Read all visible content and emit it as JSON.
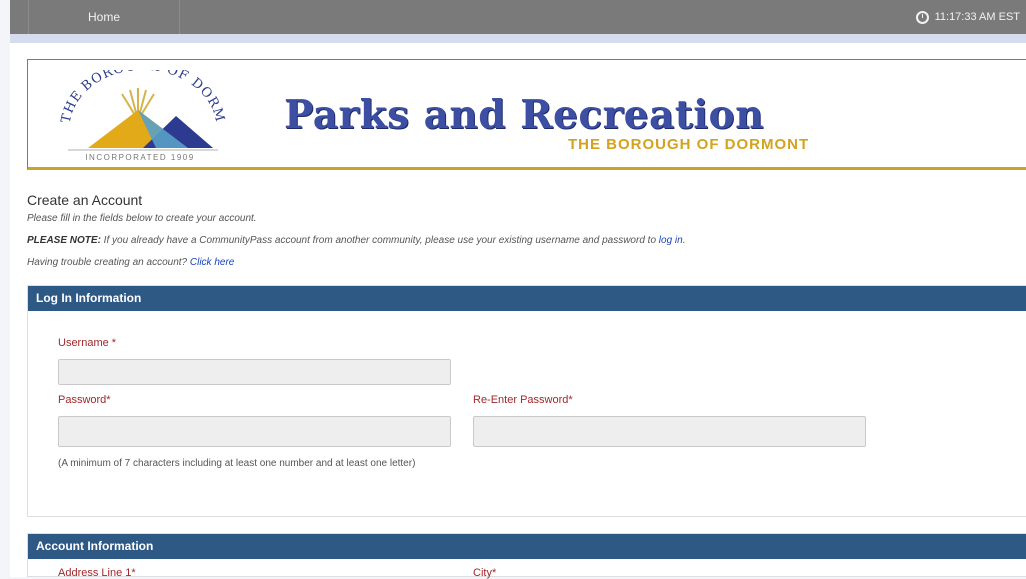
{
  "topbar": {
    "home_label": "Home",
    "time": "11:17:33 AM EST"
  },
  "banner": {
    "logo": {
      "arc_top": "BOROUGH OF DORMONT",
      "arc_left": "THE",
      "incorporated": "INCORPORATED 1909"
    },
    "title": "Parks and Recreation",
    "subtitle": "THE BOROUGH OF DORMONT"
  },
  "intro": {
    "heading": "Create an Account",
    "instructions": "Please fill in the fields below to create your account.",
    "note_label": "PLEASE NOTE:",
    "note_text": " If you already have a CommunityPass account from another community, please use your existing username and password to ",
    "login_link": "log in",
    "note_end": ".",
    "trouble_text": "Having trouble creating an account? ",
    "click_here": "Click here"
  },
  "login_panel": {
    "title": "Log In Information",
    "username_label": "Username *",
    "password_label": "Password*",
    "reenter_label": "Re-Enter Password*",
    "hint": "(A minimum of 7 characters including at least one number and at least one letter)"
  },
  "account_panel": {
    "title": "Account Information",
    "address_label": "Address Line 1*",
    "city_label": "City*"
  },
  "colors": {
    "panel_header": "#2e5984",
    "label_red": "#a0282a",
    "title_blue": "#3c4fa2",
    "subtitle_gold": "#d4a21c"
  }
}
